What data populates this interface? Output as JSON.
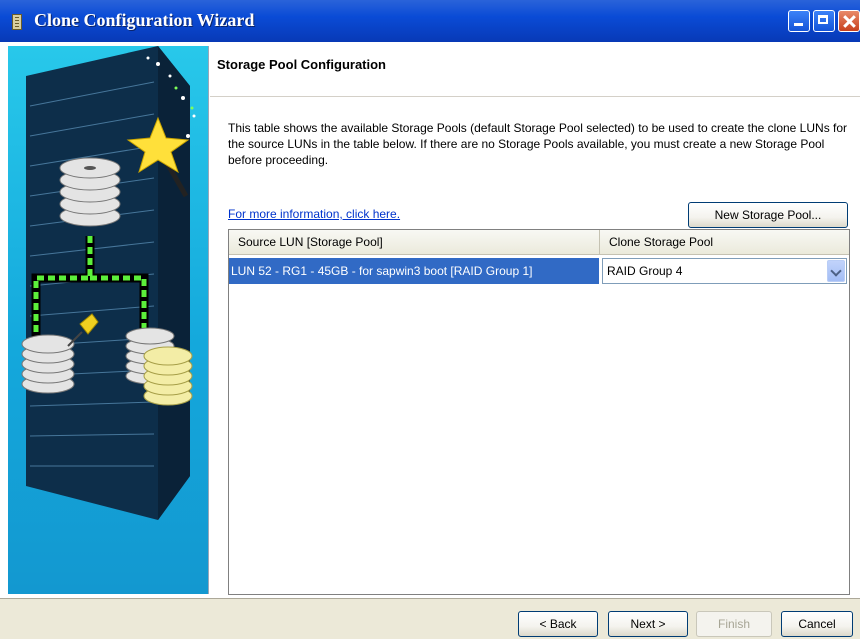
{
  "window": {
    "title": "Clone Configuration Wizard",
    "controls": [
      "minimize",
      "maximize",
      "close"
    ]
  },
  "page": {
    "title": "Storage Pool Configuration",
    "description": "This table shows the available Storage Pools (default Storage Pool selected) to be used to create the clone LUNs for the source LUNs in the table below. If there are no Storage Pools available, you must create a new Storage Pool before proceeding.",
    "more_info_link": "For more information, click here.",
    "new_pool_button": "New Storage Pool..."
  },
  "table": {
    "columns": [
      "Source LUN [Storage Pool]",
      "Clone Storage Pool"
    ],
    "rows": [
      {
        "source": "LUN 52 - RG1 - 45GB - for sapwin3 boot [RAID Group 1]",
        "clone_pool": "RAID Group 4",
        "selected": true
      }
    ]
  },
  "buttons": {
    "back": "< Back",
    "next": "Next >",
    "finish": "Finish",
    "cancel": "Cancel"
  },
  "colors": {
    "titlebar": "#0a4bd6",
    "selection": "#316ac5",
    "art_background": "#14a8dc",
    "link": "#0033cc"
  }
}
